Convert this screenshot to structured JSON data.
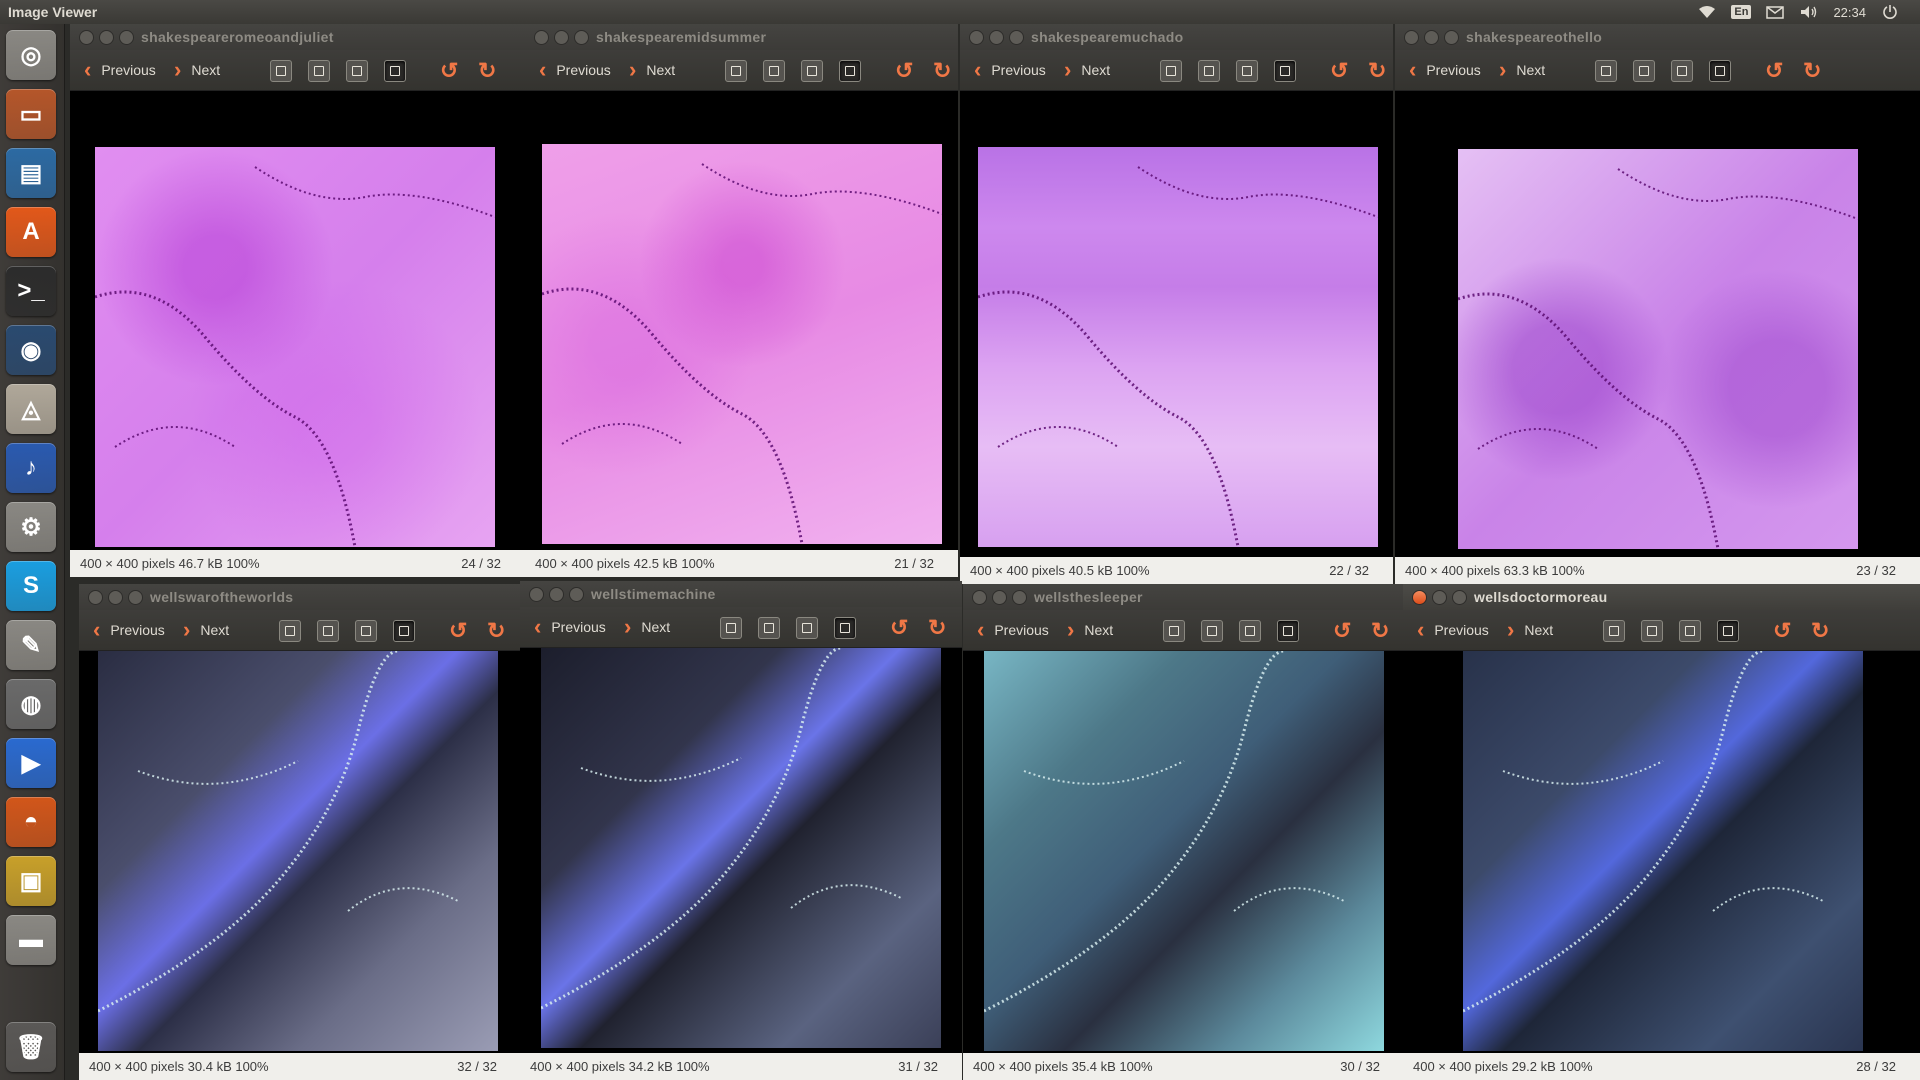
{
  "panel": {
    "app_title": "Image Viewer",
    "keyboard_layout": "En",
    "clock": "22:34"
  },
  "launcher": [
    {
      "name": "dash-icon",
      "color": "#8a8883",
      "glyph": "◎"
    },
    {
      "name": "files-icon",
      "color": "#b5562a",
      "glyph": "▭"
    },
    {
      "name": "writer-icon",
      "color": "#2c6aa3",
      "glyph": "▤"
    },
    {
      "name": "software-center-icon",
      "color": "#e2581a",
      "glyph": "A"
    },
    {
      "name": "terminal-icon",
      "color": "#2c2c2c",
      "glyph": ">_"
    },
    {
      "name": "steam-icon",
      "color": "#2a4a70",
      "glyph": "◉"
    },
    {
      "name": "map-icon",
      "color": "#b0a89a",
      "glyph": "◬"
    },
    {
      "name": "audacity-icon",
      "color": "#2a5ab0",
      "glyph": "♪"
    },
    {
      "name": "system-settings-icon",
      "color": "#8a8883",
      "glyph": "⚙"
    },
    {
      "name": "skype-icon",
      "color": "#1a9ee0",
      "glyph": "S"
    },
    {
      "name": "text-editor-icon",
      "color": "#8a8883",
      "glyph": "✎"
    },
    {
      "name": "chrome-icon",
      "color": "#6a6a6a",
      "glyph": "◍"
    },
    {
      "name": "media-player-icon",
      "color": "#2a6ad0",
      "glyph": "▶"
    },
    {
      "name": "firefox-icon",
      "color": "#d2561a",
      "glyph": "◓"
    },
    {
      "name": "image-viewer-icon",
      "color": "#c8a02a",
      "glyph": "▣"
    },
    {
      "name": "drive-icon",
      "color": "#8a8883",
      "glyph": "▬"
    },
    {
      "name": "trash-icon",
      "color": "#5a5856",
      "glyph": "🗑"
    }
  ],
  "toolbar_labels": {
    "previous": "Previous",
    "next": "Next"
  },
  "windows": [
    {
      "title": "shakespeareromeoandjuliet",
      "info": "400 × 400 pixels  46.7 kB   100%",
      "count": "24 / 32",
      "theme": "pink-a",
      "active": false
    },
    {
      "title": "shakespearemidsummer",
      "info": "400 × 400 pixels  42.5 kB   100%",
      "count": "21 / 32",
      "theme": "pink-b",
      "active": false
    },
    {
      "title": "shakespearemuchado",
      "info": "400 × 400 pixels  40.5 kB   100%",
      "count": "22 / 32",
      "theme": "pink-c",
      "active": false
    },
    {
      "title": "shakespeareothello",
      "info": "400 × 400 pixels  63.3 kB   100%",
      "count": "23 / 32",
      "theme": "pink-d",
      "active": false
    },
    {
      "title": "wellswaroftheworlds",
      "info": "400 × 400 pixels  30.4 kB   100%",
      "count": "32 / 32",
      "theme": "blue-a",
      "active": false
    },
    {
      "title": "wellstimemachine",
      "info": "400 × 400 pixels  34.2 kB   100%",
      "count": "31 / 32",
      "theme": "blue-b",
      "active": false
    },
    {
      "title": "wellsthesleeper",
      "info": "400 × 400 pixels  35.4 kB   100%",
      "count": "30 / 32",
      "theme": "blue-c",
      "active": false
    },
    {
      "title": "wellsdoctormoreau",
      "info": "400 × 400 pixels  29.2 kB   100%",
      "count": "28 / 32",
      "theme": "blue-d",
      "active": true
    }
  ]
}
